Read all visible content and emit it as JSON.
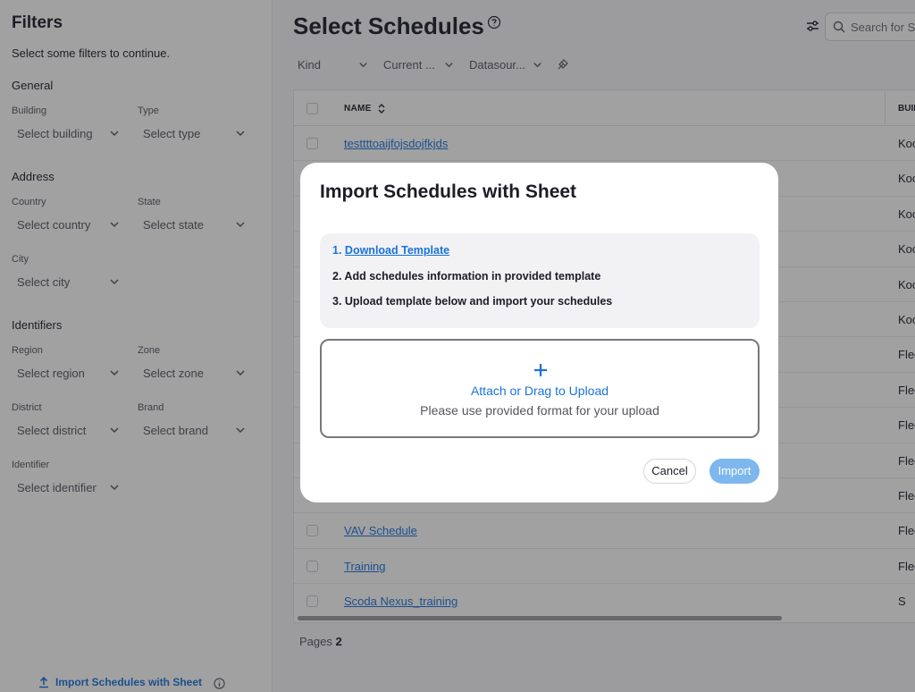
{
  "filters": {
    "title": "Filters",
    "subtitle": "Select some filters to continue.",
    "sections": {
      "general": "General",
      "address": "Address",
      "identifiers": "Identifiers"
    },
    "fields": {
      "building": {
        "label": "Building",
        "placeholder": "Select building"
      },
      "type": {
        "label": "Type",
        "placeholder": "Select type"
      },
      "country": {
        "label": "Country",
        "placeholder": "Select country"
      },
      "state": {
        "label": "State",
        "placeholder": "Select state"
      },
      "city": {
        "label": "City",
        "placeholder": "Select city"
      },
      "region": {
        "label": "Region",
        "placeholder": "Select region"
      },
      "zone": {
        "label": "Zone",
        "placeholder": "Select zone"
      },
      "district": {
        "label": "District",
        "placeholder": "Select district"
      },
      "brand": {
        "label": "Brand",
        "placeholder": "Select brand"
      },
      "identifier": {
        "label": "Identifier",
        "placeholder": "Select identifier"
      }
    },
    "import_link": "Import Schedules with Sheet"
  },
  "main": {
    "title": "Select Schedules",
    "search_placeholder": "Search for Sc",
    "chips": [
      "Kind",
      "Current ...",
      "Datasour..."
    ],
    "table": {
      "col_name": "NAME",
      "col_building": "BUIL",
      "rows": [
        {
          "name": "testtttoaijfojsdojfkjds",
          "building": "Koc"
        },
        {
          "name": "",
          "building": "Koc"
        },
        {
          "name": "",
          "building": "Koc"
        },
        {
          "name": "",
          "building": "Koc"
        },
        {
          "name": "",
          "building": "Koc"
        },
        {
          "name": "",
          "building": "Koc"
        },
        {
          "name": "",
          "building": "Flee"
        },
        {
          "name": "",
          "building": "Flee"
        },
        {
          "name": "",
          "building": "Flee"
        },
        {
          "name": "",
          "building": "Flee"
        },
        {
          "name": "",
          "building": "Flee"
        },
        {
          "name": "VAV Schedule",
          "building": "Flee"
        },
        {
          "name": "Training",
          "building": "Flee"
        },
        {
          "name": "Scoda Nexus_training",
          "building": "S"
        }
      ]
    },
    "pages_label": "Pages",
    "pages_count": "2"
  },
  "modal": {
    "title": "Import Schedules with Sheet",
    "step1_num": "1.",
    "step1_link": "Download Template",
    "step2": "2. Add schedules information in provided template",
    "step3": "3. Upload template below and import your schedules",
    "upload_main": "Attach or Drag to Upload",
    "upload_sub": "Please use provided format for your upload",
    "cancel": "Cancel",
    "import": "Import"
  },
  "colors": {
    "accent": "#1a73d9",
    "import_button": "#7db7ee"
  }
}
